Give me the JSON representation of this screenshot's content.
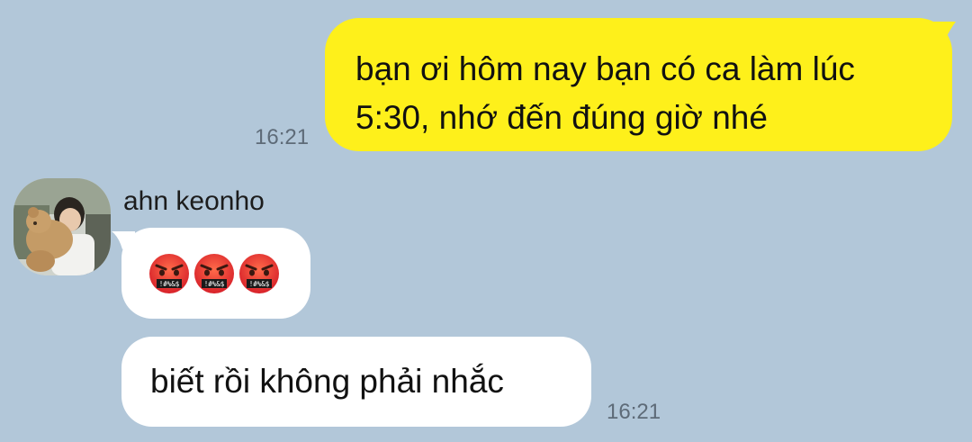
{
  "messages": [
    {
      "direction": "outgoing",
      "text_line1": "bạn ơi hôm nay bạn có ca làm lúc",
      "text_line2": "5:30, nhớ đến đúng giờ nhé",
      "time": "16:21",
      "bubble_color": "#fef01b"
    },
    {
      "direction": "incoming",
      "sender": "ahn keonho",
      "emoji": [
        "swearing-face-emoji",
        "swearing-face-emoji",
        "swearing-face-emoji"
      ],
      "emoji_symbols": [
        "!#%&$",
        "!#%&$",
        "!#%&$"
      ]
    },
    {
      "direction": "incoming",
      "text": "biết rồi không phải nhắc",
      "time": "16:21",
      "bubble_color": "#ffffff"
    }
  ],
  "colors": {
    "chat_background": "#b2c7d9",
    "timestamp": "#5e6b78"
  }
}
